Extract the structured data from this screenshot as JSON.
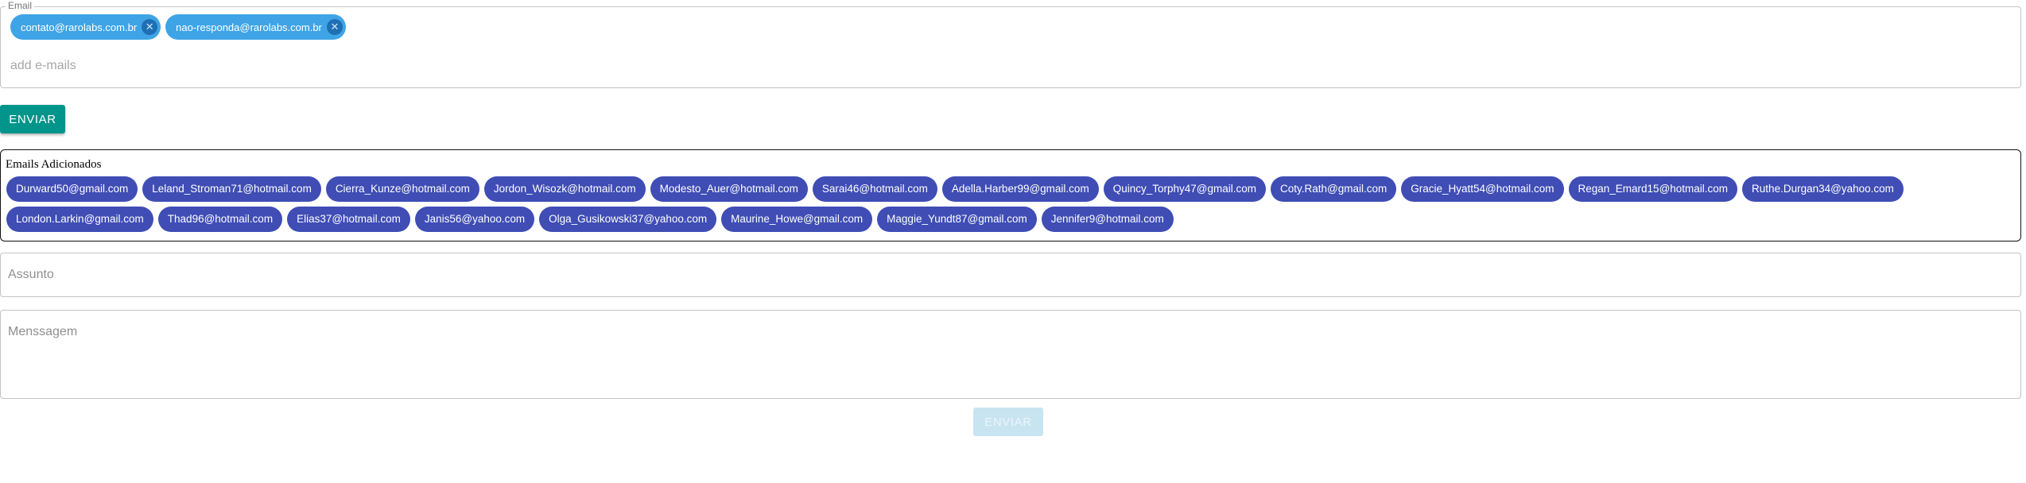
{
  "email_field": {
    "legend": "Email",
    "chips": [
      {
        "label": "contato@rarolabs.com.br",
        "remove_icon": "cancel-circle-icon"
      },
      {
        "label": "nao-responda@rarolabs.com.br",
        "remove_icon": "cancel-circle-icon"
      }
    ],
    "placeholder": "add e-mails",
    "chip_color": "#3fa4e6"
  },
  "enviar_button": {
    "label": "ENVIAR",
    "color": "#00958a"
  },
  "added_emails": {
    "title": "Emails Adicionados",
    "chip_color": "#3f4db5",
    "items": [
      "Durward50@gmail.com",
      "Leland_Stroman71@hotmail.com",
      "Cierra_Kunze@hotmail.com",
      "Jordon_Wisozk@hotmail.com",
      "Modesto_Auer@hotmail.com",
      "Sarai46@hotmail.com",
      "Adella.Harber99@gmail.com",
      "Quincy_Torphy47@gmail.com",
      "Coty.Rath@gmail.com",
      "Gracie_Hyatt54@hotmail.com",
      "Regan_Emard15@hotmail.com",
      "Ruthe.Durgan34@yahoo.com",
      "London.Larkin@gmail.com",
      "Thad96@hotmail.com",
      "Elias37@hotmail.com",
      "Janis56@yahoo.com",
      "Olga_Gusikowski37@yahoo.com",
      "Maurine_Howe@gmail.com",
      "Maggie_Yundt87@gmail.com",
      "Jennifer9@hotmail.com"
    ]
  },
  "subject_field": {
    "placeholder": "Assunto",
    "value": ""
  },
  "message_field": {
    "placeholder": "Menssagem",
    "value": ""
  },
  "submit_button": {
    "label": "ENVIAR",
    "state": "disabled",
    "color": "#c9e4f1"
  }
}
